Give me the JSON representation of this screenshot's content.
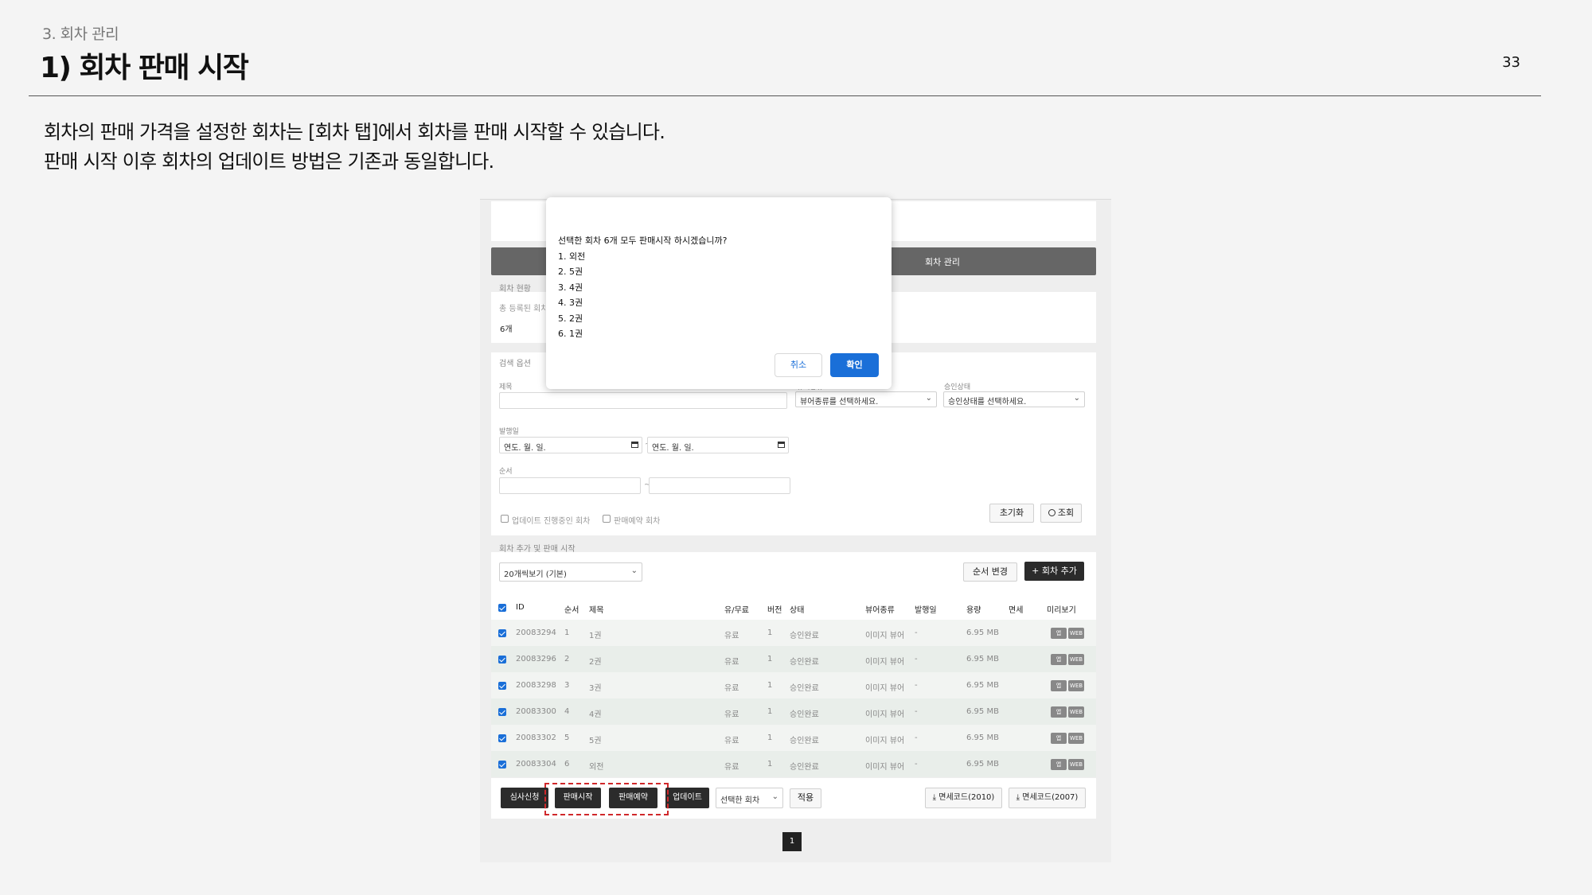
{
  "slide": {
    "section": "3. 회차 관리",
    "title": "1) 회차 판매 시작",
    "page_number": "33",
    "desc_line1": "회차의 판매 가격을 설정한 회차는 [회차 탭]에서 회차를 판매 시작할 수 있습니다.",
    "desc_line2": "판매 시작 이후 회차의 업데이트 방법은 기존과 동일합니다."
  },
  "app": {
    "mgmt_bar_label": "회차 관리",
    "status": {
      "section_label": "회차 현황",
      "total_label": "총 등록된 회차",
      "total_value": "6개"
    },
    "search": {
      "section_label": "검색 옵션",
      "title_label": "제목",
      "viewer_label": "뷰어종류",
      "viewer_placeholder": "뷰어종류를 선택하세요.",
      "approval_label": "승인상태",
      "approval_placeholder": "승인상태를 선택하세요.",
      "date_label": "발행일",
      "date_placeholder": "연도. 월. 일.",
      "range_sep": "~",
      "order_label": "순서",
      "cb_updating": "업데이트 진행중인 회차",
      "cb_reserved": "판매예약 회차",
      "reset_btn": "초기화",
      "search_btn": "조회"
    },
    "list": {
      "section_label": "회차 추가 및 판매 시작",
      "page_size": "20개씩보기 (기본)",
      "reorder_btn": "순서 변경",
      "add_btn": "+ 회차 추가",
      "headers": {
        "id": "ID",
        "order": "순서",
        "title": "제목",
        "paid": "유/무료",
        "version": "버전",
        "status": "상태",
        "viewer": "뷰어종류",
        "date": "발행일",
        "size": "용량",
        "tax": "면세",
        "preview": "미리보기"
      },
      "rows": [
        {
          "id": "20083294",
          "order": "1",
          "title": "1권",
          "paid": "유료",
          "version": "1",
          "status": "승인완료",
          "viewer": "이미지 뷰어",
          "date": "-",
          "size": "6.95 MB"
        },
        {
          "id": "20083296",
          "order": "2",
          "title": "2권",
          "paid": "유료",
          "version": "1",
          "status": "승인완료",
          "viewer": "이미지 뷰어",
          "date": "-",
          "size": "6.95 MB"
        },
        {
          "id": "20083298",
          "order": "3",
          "title": "3권",
          "paid": "유료",
          "version": "1",
          "status": "승인완료",
          "viewer": "이미지 뷰어",
          "date": "-",
          "size": "6.95 MB"
        },
        {
          "id": "20083300",
          "order": "4",
          "title": "4권",
          "paid": "유료",
          "version": "1",
          "status": "승인완료",
          "viewer": "이미지 뷰어",
          "date": "-",
          "size": "6.95 MB"
        },
        {
          "id": "20083302",
          "order": "5",
          "title": "5권",
          "paid": "유료",
          "version": "1",
          "status": "승인완료",
          "viewer": "이미지 뷰어",
          "date": "-",
          "size": "6.95 MB"
        },
        {
          "id": "20083304",
          "order": "6",
          "title": "외전",
          "paid": "유료",
          "version": "1",
          "status": "승인완료",
          "viewer": "이미지 뷰어",
          "date": "-",
          "size": "6.95 MB"
        }
      ],
      "preview_app": "앱",
      "preview_web": "WEB"
    },
    "actions": {
      "review_btn": "심사신청",
      "sale_start_btn": "판매시작",
      "sale_reserve_btn": "판매예약",
      "update_btn": "업데이트",
      "target_select": "선택한 회차",
      "apply_btn": "적용",
      "tax2010_btn": "면세코드(2010)",
      "tax2007_btn": "면세코드(2007)"
    },
    "pagination": {
      "current": "1"
    }
  },
  "modal": {
    "question": "선택한 회차 6개 모두 판매시작 하시겠습니까?",
    "items": [
      "1. 외전",
      "2. 5권",
      "3. 4권",
      "4. 3권",
      "5. 2권",
      "6. 1권"
    ],
    "cancel": "취소",
    "confirm": "확인"
  },
  "colors": {
    "accent_blue": "#1a6fd8",
    "highlight_red": "#d0282b",
    "dark_button": "#2b2b2b"
  }
}
